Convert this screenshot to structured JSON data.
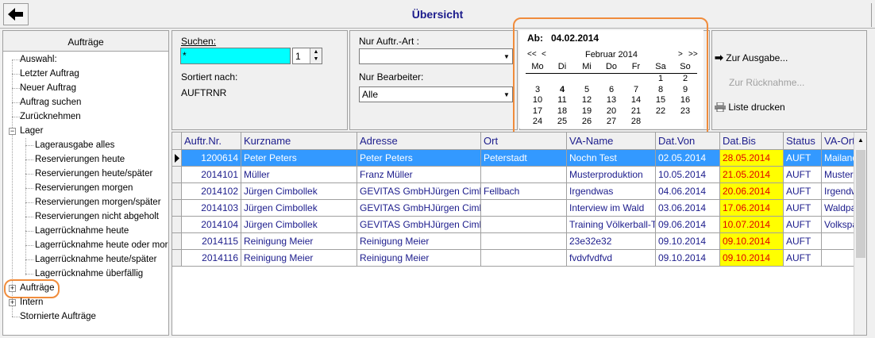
{
  "header": {
    "title": "Übersicht",
    "back_icon": "left-arrow-icon"
  },
  "sidebar": {
    "title": "Aufträge",
    "items": [
      {
        "label": "Auswahl:"
      },
      {
        "label": "Letzter Auftrag"
      },
      {
        "label": "Neuer Auftrag"
      },
      {
        "label": "Auftrag suchen"
      },
      {
        "label": "Zurücknehmen"
      },
      {
        "label": "Lager"
      },
      {
        "label": "Lagerausgabe alles"
      },
      {
        "label": "Reservierungen heute"
      },
      {
        "label": "Reservierungen heute/später"
      },
      {
        "label": "Reservierungen morgen"
      },
      {
        "label": "Reservierungen morgen/später"
      },
      {
        "label": "Reservierungen nicht abgeholt"
      },
      {
        "label": "Lagerrücknahme heute"
      },
      {
        "label": "Lagerrücknahme heute oder morgen"
      },
      {
        "label": "Lagerrücknahme heute/später"
      },
      {
        "label": "Lagerrücknahme überfällig"
      },
      {
        "label": "Aufträge"
      },
      {
        "label": "Intern"
      },
      {
        "label": "Stornierte Aufträge"
      }
    ]
  },
  "search": {
    "label": "Suchen:",
    "value": "*",
    "spin_value": "1",
    "sorted_label": "Sortiert nach:",
    "sorted_value": "AUFTRNR"
  },
  "filters": {
    "art_label": "Nur Auftr.-Art :",
    "art_value": "",
    "bearbeiter_label": "Nur Bearbeiter:",
    "bearbeiter_value": "Alle"
  },
  "calendar": {
    "ab_label": "Ab:",
    "ab_date": "04.02.2014",
    "nav": {
      "prev_year": "<<",
      "prev": "<",
      "next": ">",
      "next_year": ">>"
    },
    "month_label": "Februar 2014",
    "weekdays": [
      "Mo",
      "Di",
      "Mi",
      "Do",
      "Fr",
      "Sa",
      "So"
    ],
    "weeks": [
      [
        "",
        "",
        "",
        "",
        "",
        "1",
        "2"
      ],
      [
        "3",
        "4",
        "5",
        "6",
        "7",
        "8",
        "9"
      ],
      [
        "10",
        "11",
        "12",
        "13",
        "14",
        "15",
        "16"
      ],
      [
        "17",
        "18",
        "19",
        "20",
        "21",
        "22",
        "23"
      ],
      [
        "24",
        "25",
        "26",
        "27",
        "28",
        "",
        ""
      ]
    ],
    "bold_day": "4"
  },
  "actions": {
    "ausgabe": "Zur Ausgabe...",
    "ruecknahme": "Zur Rücknahme...",
    "drucken": "Liste drucken"
  },
  "table": {
    "columns": [
      "Auftr.Nr.",
      "Kurzname",
      "Adresse",
      "Ort",
      "VA-Name",
      "Dat.Von",
      "Dat.Bis",
      "Status",
      "VA-Ort"
    ],
    "rows": [
      [
        "1200614",
        "Peter Peters",
        "Peter Peters",
        "Peterstadt",
        "Nochn Test",
        "02.05.2014",
        "28.05.2014",
        "AUFT",
        "Mailand"
      ],
      [
        "2014101",
        "Müller",
        "Franz Müller",
        "",
        "Musterproduktion",
        "10.05.2014",
        "21.05.2014",
        "AUFT",
        "Musterstadt"
      ],
      [
        "2014102",
        "Jürgen Cimbollek",
        "GEVITAS GmbHJürgen Cimbollek",
        "Fellbach",
        "Irgendwas",
        "04.06.2014",
        "20.06.2014",
        "AUFT",
        "Irgendwo"
      ],
      [
        "2014103",
        "Jürgen Cimbollek",
        "GEVITAS GmbHJürgen Cimbollek",
        "",
        "Interview im Wald",
        "03.06.2014",
        "17.06.2014",
        "AUFT",
        "Waldpark"
      ],
      [
        "2014104",
        "Jürgen Cimbollek",
        "GEVITAS GmbHJürgen Cimbollek",
        "",
        "Training Völkerball-Team",
        "09.06.2014",
        "10.07.2014",
        "AUFT",
        "Volkspark"
      ],
      [
        "2014115",
        "Reinigung Meier",
        "Reinigung Meier",
        "",
        "23e32e32",
        "09.10.2014",
        "09.10.2014",
        "AUFT",
        ""
      ],
      [
        "2014116",
        "Reinigung Meier",
        "Reinigung Meier",
        "",
        "fvdvfvdfvd",
        "09.10.2014",
        "09.10.2014",
        "AUFT",
        ""
      ]
    ],
    "selected_row": 0
  },
  "colors": {
    "accent": "#1c1c8c",
    "selection": "#3399ff",
    "highlight": "#ffff00",
    "highlight_text": "#e00000",
    "callout": "#f08c3c"
  }
}
